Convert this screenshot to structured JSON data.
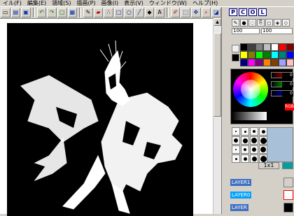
{
  "menu": [
    "イル(F)",
    "編集(E)",
    "領域(S)",
    "描画(P)",
    "画像(I)",
    "表示(V)",
    "ウィンドウ(W)",
    "ヘルプ(H)"
  ],
  "panel": {
    "tabs": [
      "P",
      "C",
      "O",
      "L"
    ],
    "brush_size": "100",
    "opacity": "100",
    "rgb": {
      "r": "0",
      "g": "0",
      "b": "0"
    },
    "rgb_label": "RGB",
    "zoom": "1x1",
    "layers": [
      {
        "label": "LAYER1",
        "active": false
      },
      {
        "label": "LAYER0",
        "active": true
      },
      {
        "label": "LAYER",
        "active": false
      }
    ]
  },
  "colors": {
    "accent": "#000080",
    "palette": [
      "#000000",
      "#404040",
      "#808080",
      "#c0c0c0",
      "#ffffff",
      "#ff0000",
      "#800000",
      "#ffff00",
      "#808000",
      "#00ff00",
      "#008000",
      "#00ffff",
      "#008080",
      "#0000ff",
      "#000080",
      "#ff00ff",
      "#800080",
      "#ff8000",
      "#804000",
      "#a0a0ff",
      "#ffc0c0"
    ]
  }
}
